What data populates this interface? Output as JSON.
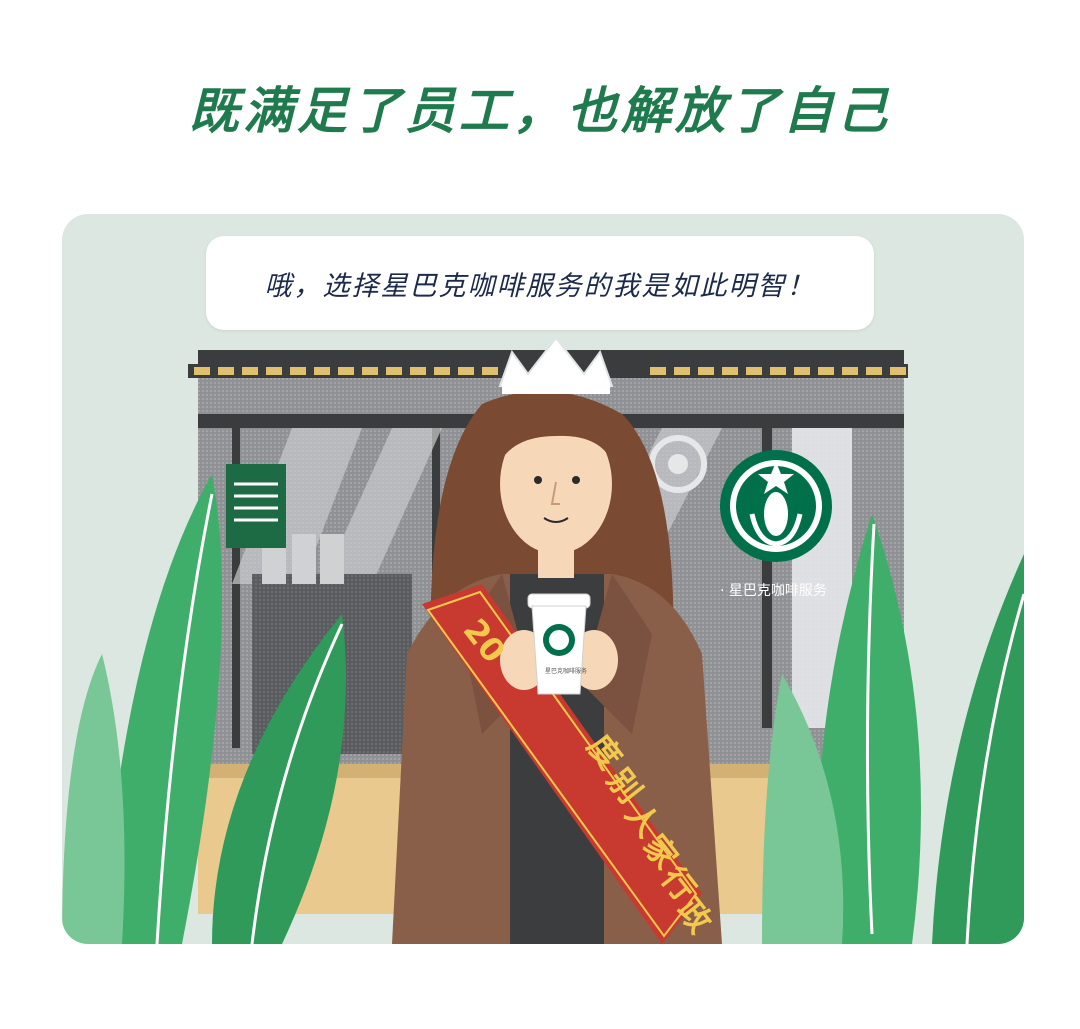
{
  "headline": "既满足了员工，也解放了自己",
  "bubble_text": "哦，选择星巴克咖啡服务的我是如此明智！",
  "store_sign": "· 星巴克咖啡服务",
  "cup_label": "星巴克咖啡服务",
  "sash_chars": [
    "20",
    "度",
    "别",
    "人",
    "家",
    "行",
    "政"
  ],
  "colors": {
    "headline": "#1f7a4d",
    "card_bg": "#dbe7e0",
    "bubble_text": "#1c2b4a",
    "leaf_green": "#3fae6a",
    "leaf_light": "#79c796",
    "coat_brown": "#8a5f4a",
    "sash_red": "#c8392f",
    "hair_brown": "#7a4a32",
    "counter_tan": "#e9c98e",
    "starbucks_green": "#00704a"
  },
  "icons": [
    "crown-icon",
    "starbucks-logo-icon",
    "coffee-cup-icon",
    "leaf-icon"
  ]
}
